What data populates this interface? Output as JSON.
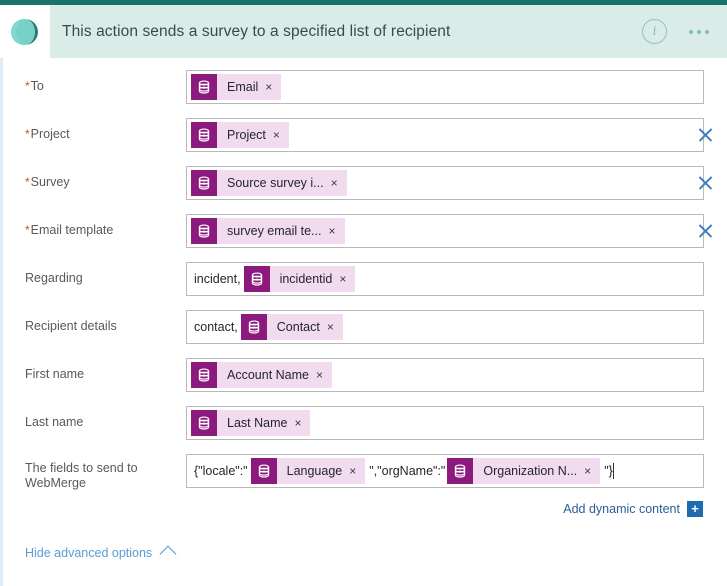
{
  "header": {
    "title": "This action sends a survey to a specified list of recipient",
    "logo_name": "dynamics-365-logo",
    "info_label": "i",
    "info_name": "info-icon",
    "more_name": "more-options-icon"
  },
  "colors": {
    "top_strip": "#1a7367",
    "header_bg": "#d9ece8",
    "chip_icon_bg": "#8c1a7d",
    "chip_bg": "#f1dcef",
    "clear_x": "#3f7fc1",
    "link_blue": "#2b5f96",
    "required_star": "#d24726"
  },
  "fields": [
    {
      "label": "To",
      "required": true,
      "prefix": "",
      "tokens": [
        {
          "label": "Email",
          "icon": "database-icon"
        }
      ],
      "suffix": "",
      "has_clear": false,
      "caret": false
    },
    {
      "label": "Project",
      "required": true,
      "prefix": "",
      "tokens": [
        {
          "label": "Project",
          "icon": "database-icon"
        }
      ],
      "suffix": "",
      "has_clear": true,
      "caret": false
    },
    {
      "label": "Survey",
      "required": true,
      "prefix": "",
      "tokens": [
        {
          "label": "Source survey i...",
          "icon": "database-icon"
        }
      ],
      "suffix": "",
      "has_clear": true,
      "caret": false
    },
    {
      "label": "Email template",
      "required": true,
      "prefix": "",
      "tokens": [
        {
          "label": "survey email te...",
          "icon": "database-icon"
        }
      ],
      "suffix": "",
      "has_clear": true,
      "caret": false
    },
    {
      "label": "Regarding",
      "required": false,
      "prefix": "incident,",
      "tokens": [
        {
          "label": "incidentid",
          "icon": "database-icon"
        }
      ],
      "suffix": "",
      "has_clear": false,
      "caret": false
    },
    {
      "label": "Recipient details",
      "required": false,
      "prefix": "contact,",
      "tokens": [
        {
          "label": "Contact",
          "icon": "database-icon"
        }
      ],
      "suffix": "",
      "has_clear": false,
      "caret": false
    },
    {
      "label": "First name",
      "required": false,
      "prefix": "",
      "tokens": [
        {
          "label": "Account Name",
          "icon": "database-icon"
        }
      ],
      "suffix": "",
      "has_clear": false,
      "caret": false
    },
    {
      "label": "Last name",
      "required": false,
      "prefix": "",
      "tokens": [
        {
          "label": "Last Name",
          "icon": "database-icon"
        }
      ],
      "suffix": "",
      "has_clear": false,
      "caret": false
    },
    {
      "label": "The fields to send to WebMerge",
      "required": false,
      "prefix": "{\"locale\":\"",
      "tokens": [
        {
          "label": "Language",
          "icon": "database-icon"
        },
        {
          "label": "Organization N...",
          "icon": "database-icon"
        }
      ],
      "mid": "\",\"orgName\":\"",
      "suffix": "\"}",
      "has_clear": false,
      "caret": true
    }
  ],
  "add_dynamic_content": {
    "label": "Add dynamic content",
    "plus_label": "+"
  },
  "advanced_options": {
    "label": "Hide advanced options",
    "chevron": "chevron-up-icon"
  }
}
